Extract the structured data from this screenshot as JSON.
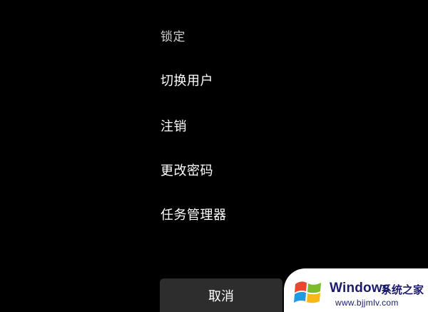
{
  "menu": {
    "items": [
      {
        "label": "锁定"
      },
      {
        "label": "切换用户"
      },
      {
        "label": "注销"
      },
      {
        "label": "更改密码"
      },
      {
        "label": "任务管理器"
      }
    ]
  },
  "cancel_button": {
    "label": "取消"
  },
  "watermark": {
    "brand": "Windows",
    "cn_text": "系统之家",
    "url": "www.bjjmlv.com",
    "colors": {
      "red": "#e8472b",
      "green": "#7cbb2a",
      "blue": "#1e9ae0",
      "yellow": "#f9b815",
      "text": "#1b1b6b"
    }
  }
}
